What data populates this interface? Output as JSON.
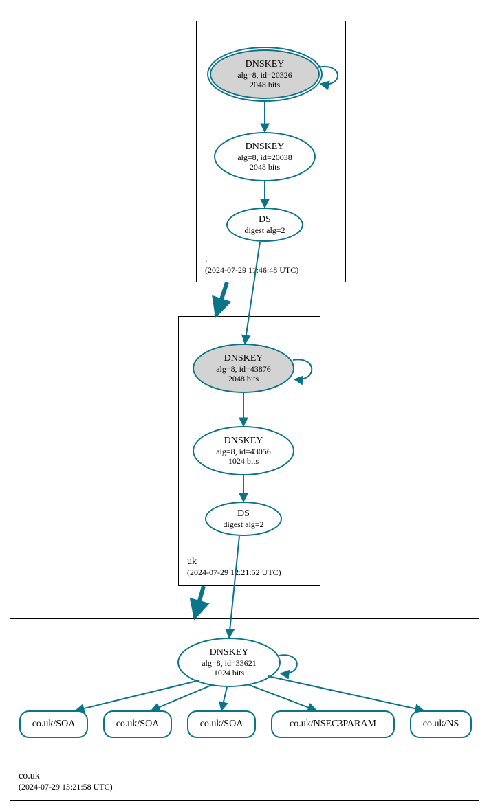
{
  "colors": {
    "edge": "#0c7489",
    "fill": "#d3d3d3"
  },
  "zones": {
    "root": {
      "name": ".",
      "timestamp": "(2024-07-29 11:46:48 UTC)"
    },
    "uk": {
      "name": "uk",
      "timestamp": "(2024-07-29 12:21:52 UTC)"
    },
    "couk": {
      "name": "co.uk",
      "timestamp": "(2024-07-29 13:21:58 UTC)"
    }
  },
  "nodes": {
    "root_ksk": {
      "title": "DNSKEY",
      "sub1": "alg=8, id=20326",
      "sub2": "2048 bits"
    },
    "root_zsk": {
      "title": "DNSKEY",
      "sub1": "alg=8, id=20038",
      "sub2": "2048 bits"
    },
    "root_ds": {
      "title": "DS",
      "sub1": "digest alg=2",
      "sub2": ""
    },
    "uk_ksk": {
      "title": "DNSKEY",
      "sub1": "alg=8, id=43876",
      "sub2": "2048 bits"
    },
    "uk_zsk": {
      "title": "DNSKEY",
      "sub1": "alg=8, id=43056",
      "sub2": "1024 bits"
    },
    "uk_ds": {
      "title": "DS",
      "sub1": "digest alg=2",
      "sub2": ""
    },
    "couk_key": {
      "title": "DNSKEY",
      "sub1": "alg=8, id=33621",
      "sub2": "1024 bits"
    },
    "rr_soa1": {
      "label": "co.uk/SOA"
    },
    "rr_soa2": {
      "label": "co.uk/SOA"
    },
    "rr_soa3": {
      "label": "co.uk/SOA"
    },
    "rr_nsec3": {
      "label": "co.uk/NSEC3PARAM"
    },
    "rr_ns": {
      "label": "co.uk/NS"
    }
  }
}
